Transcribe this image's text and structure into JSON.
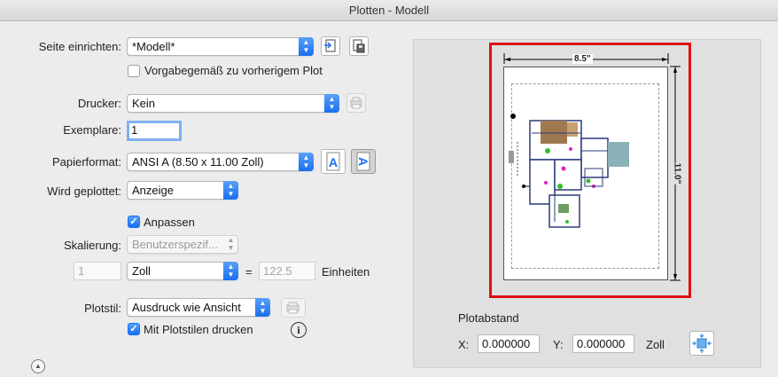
{
  "window": {
    "title": "Plotten - Modell"
  },
  "page_setup": {
    "label": "Seite einrichten:",
    "value": "*Modell*",
    "prev_checkbox_label": "Vorgabegemäß zu vorherigem Plot"
  },
  "printer": {
    "label": "Drucker:",
    "value": "Kein"
  },
  "copies": {
    "label": "Exemplare:",
    "value": "1"
  },
  "paper_size": {
    "label": "Papierformat:",
    "value": "ANSI A (8.50 x 11.00 Zoll)"
  },
  "plot_area": {
    "label": "Wird geplottet:",
    "value": "Anzeige"
  },
  "fit": {
    "label": "Anpassen",
    "checked": true
  },
  "scale": {
    "label": "Skalierung:",
    "value": "Benutzerspezif...",
    "left_value": "1",
    "unit": "Zoll",
    "equals": "=",
    "right_value": "122.5",
    "units_label": "Einheiten"
  },
  "plot_style": {
    "label": "Plotstil:",
    "value": "Ausdruck wie Ansicht",
    "with_styles_label": "Mit Plotstilen drucken",
    "with_styles_checked": true
  },
  "preview": {
    "width_dim": "8.5\"",
    "height_dim": "11.0\"",
    "frame_color": "#e01010"
  },
  "offset": {
    "title": "Plotabstand",
    "x_label": "X:",
    "x_value": "0.000000",
    "y_label": "Y:",
    "y_value": "0.000000",
    "unit": "Zoll"
  },
  "icons": {
    "page_setup_import": "import-page-icon",
    "page_setup_save": "save-page-icon",
    "printer_props": "printer-properties-icon",
    "portrait": "portrait-orientation-icon",
    "landscape": "landscape-orientation-icon",
    "plot_style_edit": "edit-plotstyle-icon",
    "info": "info-icon",
    "center": "center-plot-icon",
    "expand": "expand-up-icon"
  }
}
